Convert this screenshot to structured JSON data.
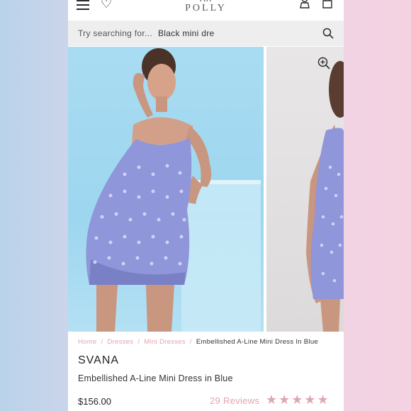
{
  "header": {
    "logo_script": "oh",
    "logo_word": "POLLY",
    "icons": [
      "menu-icon",
      "heart-icon",
      "account-icon",
      "bag-icon"
    ]
  },
  "search": {
    "placeholder": "Try searching for...",
    "value": "Black mini dre"
  },
  "gallery": {
    "slides": [
      "model-front-blue-background",
      "model-side-grey-background"
    ],
    "dress_color": "#8f96d9",
    "bg_blue": "#a9dcf2"
  },
  "breadcrumb": {
    "items": [
      "Home",
      "Dresses",
      "Mini Dresses"
    ],
    "separator": "/",
    "current": "Embellished A-Line Mini Dress In Blue"
  },
  "product": {
    "brand": "SVANA",
    "name": "Embellished A-Line Mini Dress in Blue",
    "price": "$156.00",
    "reviews": "29 Reviews",
    "rating": 5,
    "stars": "★★★★★"
  },
  "colors": {
    "accent_pink": "#e3a3ad",
    "text_dark": "#222222"
  }
}
